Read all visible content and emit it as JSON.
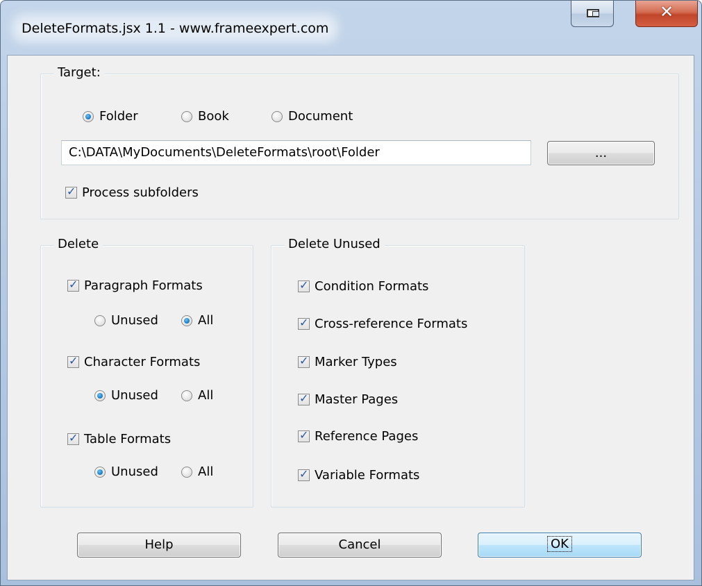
{
  "window": {
    "title": "DeleteFormats.jsx 1.1 - www.frameexpert.com"
  },
  "target": {
    "legend": "Target:",
    "options": [
      {
        "label": "Folder",
        "selected": true
      },
      {
        "label": "Book",
        "selected": false
      },
      {
        "label": "Document",
        "selected": false
      }
    ],
    "path": "C:\\DATA\\MyDocuments\\DeleteFormats\\root\\Folder",
    "browse_label": "...",
    "subfolders_label": "Process subfolders",
    "subfolders_checked": true
  },
  "delete": {
    "legend": "Delete",
    "items": [
      {
        "label": "Paragraph Formats",
        "checked": true,
        "unused_label": "Unused",
        "all_label": "All",
        "scope": "All"
      },
      {
        "label": "Character Formats",
        "checked": true,
        "unused_label": "Unused",
        "all_label": "All",
        "scope": "Unused"
      },
      {
        "label": "Table Formats",
        "checked": true,
        "unused_label": "Unused",
        "all_label": "All",
        "scope": "Unused"
      }
    ]
  },
  "delete_unused": {
    "legend": "Delete Unused",
    "items": [
      {
        "label": "Condition Formats",
        "checked": true
      },
      {
        "label": "Cross-reference Formats",
        "checked": true
      },
      {
        "label": "Marker Types",
        "checked": true
      },
      {
        "label": "Master Pages",
        "checked": true
      },
      {
        "label": "Reference Pages",
        "checked": true
      },
      {
        "label": "Variable Formats",
        "checked": true
      }
    ]
  },
  "buttons": {
    "help": "Help",
    "cancel": "Cancel",
    "ok": "OK"
  },
  "colors": {
    "accent_radio": "#1f7fc8",
    "check_mark": "#2c56a8",
    "default_button": "#a7d9f5",
    "close_button": "#c2452a"
  }
}
